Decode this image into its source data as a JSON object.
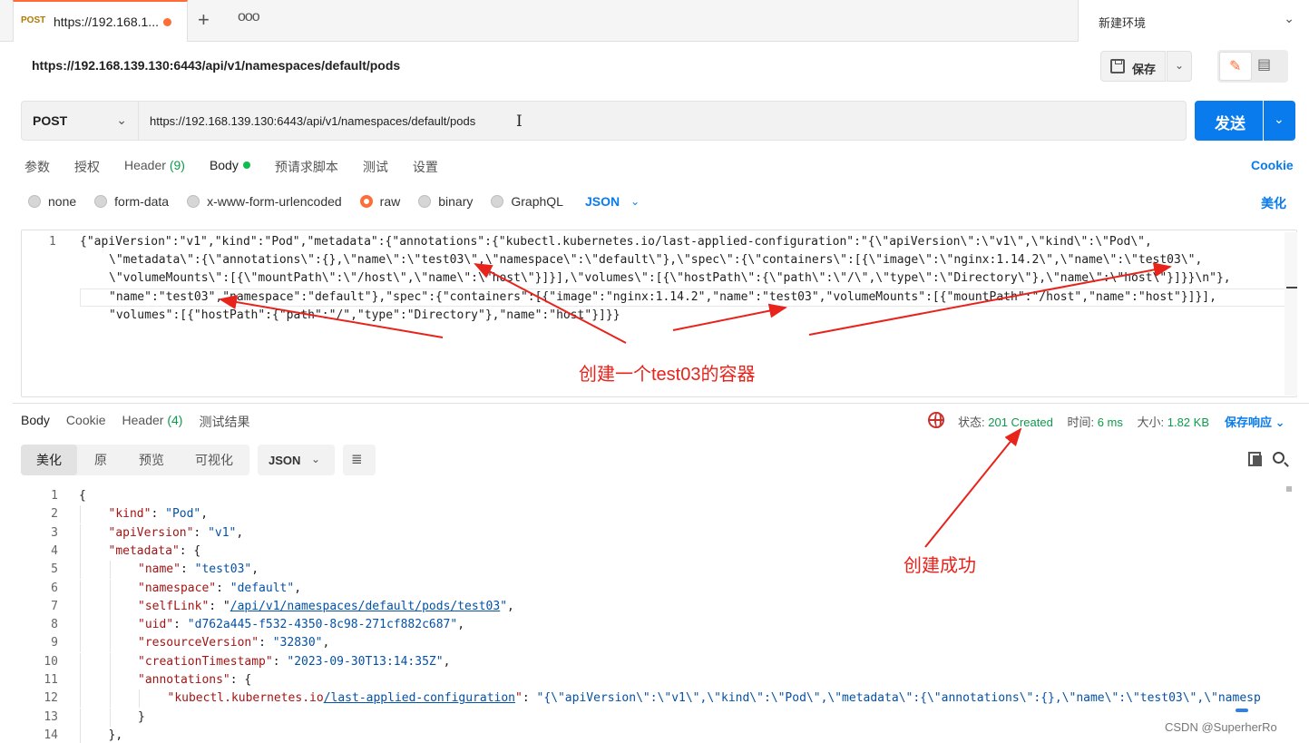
{
  "tabbar": {
    "tab_method": "POST",
    "tab_title": "https://192.168.1...",
    "add_label": "+",
    "more_label": "ooo",
    "environment": "新建环境"
  },
  "request_title": "https://192.168.139.130:6443/api/v1/namespaces/default/pods",
  "toolbar": {
    "save_label": "保存"
  },
  "url_bar": {
    "method": "POST",
    "url": "https://192.168.139.130:6443/api/v1/namespaces/default/pods",
    "send_label": "发送"
  },
  "request_tabs": [
    {
      "label": "参数"
    },
    {
      "label": "授权"
    },
    {
      "label": "Header",
      "count": "(9)"
    },
    {
      "label": "Body"
    },
    {
      "label": "预请求脚本"
    },
    {
      "label": "测试"
    },
    {
      "label": "设置"
    }
  ],
  "cookie_label": "Cookie",
  "body_types": [
    "none",
    "form-data",
    "x-www-form-urlencoded",
    "raw",
    "binary",
    "GraphQL"
  ],
  "body_format": "JSON",
  "beautify_label": "美化",
  "request_body": {
    "line_number": "1",
    "lines": [
      "{\"apiVersion\":\"v1\",\"kind\":\"Pod\",\"metadata\":{\"annotations\":{\"kubectl.kubernetes.io/last-applied-configuration\":\"{\\\"apiVersion\\\":\\\"v1\\\",\\\"kind\\\":\\\"Pod\\\",",
      "\\\"metadata\\\":{\\\"annotations\\\":{},\\\"name\\\":\\\"test03\\\",\\\"namespace\\\":\\\"default\\\"},\\\"spec\\\":{\\\"containers\\\":[{\\\"image\\\":\\\"nginx:1.14.2\\\",\\\"name\\\":\\\"test03\\\",",
      "\\\"volumeMounts\\\":[{\\\"mountPath\\\":\\\"/host\\\",\\\"name\\\":\\\"host\\\"}]}],\\\"volumes\\\":[{\\\"hostPath\\\":{\\\"path\\\":\\\"/\\\",\\\"type\\\":\\\"Directory\\\"},\\\"name\\\":\\\"host\\\"}]}}\\n\"},",
      "\"name\":\"test03\",\"namespace\":\"default\"},\"spec\":{\"containers\":[{\"image\":\"nginx:1.14.2\",\"name\":\"test03\",\"volumeMounts\":[{\"mountPath\":\"/host\",\"name\":\"host\"}]}],",
      "\"volumes\":[{\"hostPath\":{\"path\":\"/\",\"type\":\"Directory\"},\"name\":\"host\"}]}}"
    ]
  },
  "response_tabs": [
    {
      "label": "Body"
    },
    {
      "label": "Cookie"
    },
    {
      "label": "Header",
      "count": "(4)"
    },
    {
      "label": "测试结果"
    }
  ],
  "response_stats": {
    "status_label": "状态:",
    "status_value": "201 Created",
    "time_label": "时间:",
    "time_value": "6 ms",
    "size_label": "大小:",
    "size_value": "1.82 KB",
    "save_response": "保存响应"
  },
  "view_modes": [
    "美化",
    "原",
    "预览",
    "可视化"
  ],
  "response_format": "JSON",
  "response_lines": [
    {
      "n": "1",
      "indent": 0,
      "parts": [
        [
          "p",
          "{"
        ]
      ]
    },
    {
      "n": "2",
      "indent": 1,
      "parts": [
        [
          "k",
          "\"kind\""
        ],
        [
          "p",
          ": "
        ],
        [
          "s",
          "\"Pod\""
        ],
        [
          "p",
          ","
        ]
      ]
    },
    {
      "n": "3",
      "indent": 1,
      "parts": [
        [
          "k",
          "\"apiVersion\""
        ],
        [
          "p",
          ": "
        ],
        [
          "s",
          "\"v1\""
        ],
        [
          "p",
          ","
        ]
      ]
    },
    {
      "n": "4",
      "indent": 1,
      "parts": [
        [
          "k",
          "\"metadata\""
        ],
        [
          "p",
          ": {"
        ]
      ]
    },
    {
      "n": "5",
      "indent": 2,
      "parts": [
        [
          "k",
          "\"name\""
        ],
        [
          "p",
          ": "
        ],
        [
          "s",
          "\"test03\""
        ],
        [
          "p",
          ","
        ]
      ]
    },
    {
      "n": "6",
      "indent": 2,
      "parts": [
        [
          "k",
          "\"namespace\""
        ],
        [
          "p",
          ": "
        ],
        [
          "s",
          "\"default\""
        ],
        [
          "p",
          ","
        ]
      ]
    },
    {
      "n": "7",
      "indent": 2,
      "parts": [
        [
          "k",
          "\"selfLink\""
        ],
        [
          "p",
          ": \""
        ],
        [
          "lnk",
          "/api/v1/namespaces/default/pods/test03"
        ],
        [
          "s",
          "\""
        ],
        [
          "p",
          ","
        ]
      ]
    },
    {
      "n": "8",
      "indent": 2,
      "parts": [
        [
          "k",
          "\"uid\""
        ],
        [
          "p",
          ": "
        ],
        [
          "s",
          "\"d762a445-f532-4350-8c98-271cf882c687\""
        ],
        [
          "p",
          ","
        ]
      ]
    },
    {
      "n": "9",
      "indent": 2,
      "parts": [
        [
          "k",
          "\"resourceVersion\""
        ],
        [
          "p",
          ": "
        ],
        [
          "s",
          "\"32830\""
        ],
        [
          "p",
          ","
        ]
      ]
    },
    {
      "n": "10",
      "indent": 2,
      "parts": [
        [
          "k",
          "\"creationTimestamp\""
        ],
        [
          "p",
          ": "
        ],
        [
          "s",
          "\"2023-09-30T13:14:35Z\""
        ],
        [
          "p",
          ","
        ]
      ]
    },
    {
      "n": "11",
      "indent": 2,
      "parts": [
        [
          "k",
          "\"annotations\""
        ],
        [
          "p",
          ": {"
        ]
      ]
    },
    {
      "n": "12",
      "indent": 3,
      "parts": [
        [
          "k",
          "\"kubectl.kubernetes.io"
        ],
        [
          "lnk",
          "/last-applied-configuration"
        ],
        [
          "k",
          "\""
        ],
        [
          "p",
          ": "
        ],
        [
          "s",
          "\"{\\\"apiVersion\\\":\\\"v1\\\",\\\"kind\\\":\\\"Pod\\\",\\\"metadata\\\":{\\\"annotations\\\":{},\\\"name\\\":\\\"test03\\\",\\\"namesp"
        ]
      ]
    },
    {
      "n": "13",
      "indent": 2,
      "parts": [
        [
          "p",
          "}"
        ]
      ]
    },
    {
      "n": "14",
      "indent": 1,
      "parts": [
        [
          "p",
          "},"
        ]
      ]
    }
  ],
  "annotations": {
    "create_container": "创建一个test03的容器",
    "create_success": "创建成功"
  },
  "watermark": "CSDN @SuperherRo",
  "colors": {
    "accent": "#ff6c37",
    "primary": "#097bed",
    "annotation": "#e8231b",
    "success": "#0c9c4a"
  }
}
